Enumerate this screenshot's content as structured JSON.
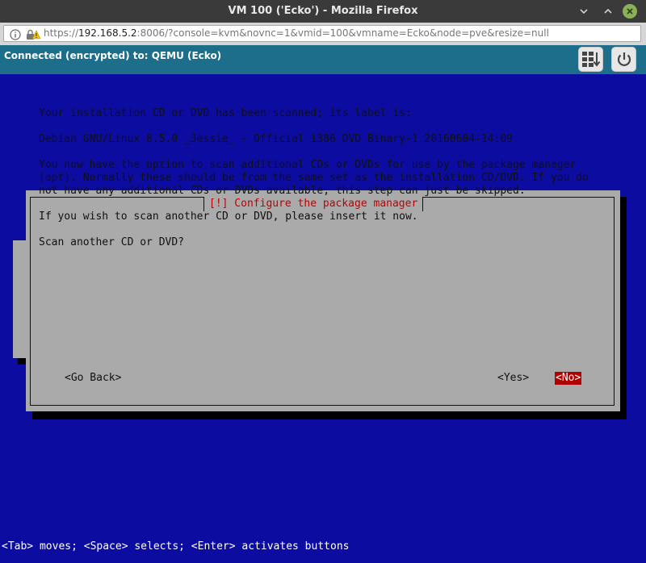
{
  "window": {
    "title": "VM 100 ('Ecko') - Mozilla Firefox"
  },
  "url": {
    "prefix": "https://",
    "host": "192.168.5.2",
    "rest": ":8006/?console=kvm&novnc=1&vmid=100&vmname=Ecko&node=pve&resize=null"
  },
  "vnc": {
    "status": "Connected (encrypted) to: QEMU (Ecko)"
  },
  "dialog": {
    "title": "[!] Configure the package manager",
    "scanned": "Your installation CD or DVD has been scanned; its label is:",
    "label": "Debian GNU/Linux 8.5.0 _Jessie_ - Official i386 DVD Binary-1 20160604-14:09",
    "option_line1": "You now have the option to scan additional CDs or DVDs for use by the package manager",
    "option_line2": "(apt). Normally these should be from the same set as the installation CD/DVD. If you do",
    "option_line3": "not have any additional CDs or DVDs available, this step can just be skipped.",
    "insert": "If you wish to scan another CD or DVD, please insert it now.",
    "question": "Scan another CD or DVD?",
    "buttons": {
      "go_back": "<Go Back>",
      "yes": "<Yes>",
      "no": "<No>"
    }
  },
  "help": "<Tab> moves; <Space> selects; <Enter> activates buttons",
  "colors": {
    "console_bg": "#0c0ca0",
    "dialog_bg": "#aaaaaa",
    "title_red": "#c00000",
    "selected_button": "#b00000",
    "vnc_bar": "#1d6e8a"
  }
}
